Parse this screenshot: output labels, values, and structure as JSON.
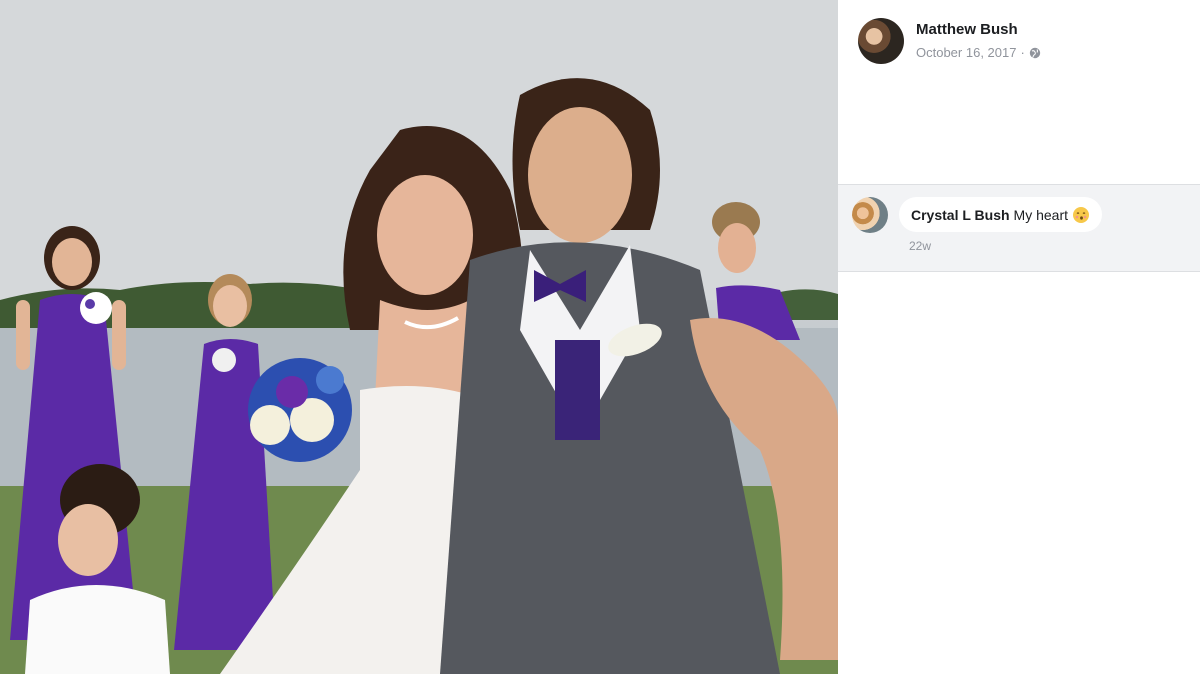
{
  "post": {
    "author": "Matthew Bush",
    "date": "October 16, 2017",
    "separator": "·",
    "privacy_icon": "globe-icon",
    "photo_description_icon": "wedding-photo"
  },
  "comments": [
    {
      "author": "Crystal L Bush",
      "text": "My heart",
      "emoji": "kissing-face-icon",
      "time": "22w"
    }
  ],
  "colors": {
    "text_primary": "#1c1e21",
    "text_secondary": "#90949c",
    "comment_area_bg": "#f2f3f5",
    "bridesmaid_dress": "#5b2aa6"
  }
}
